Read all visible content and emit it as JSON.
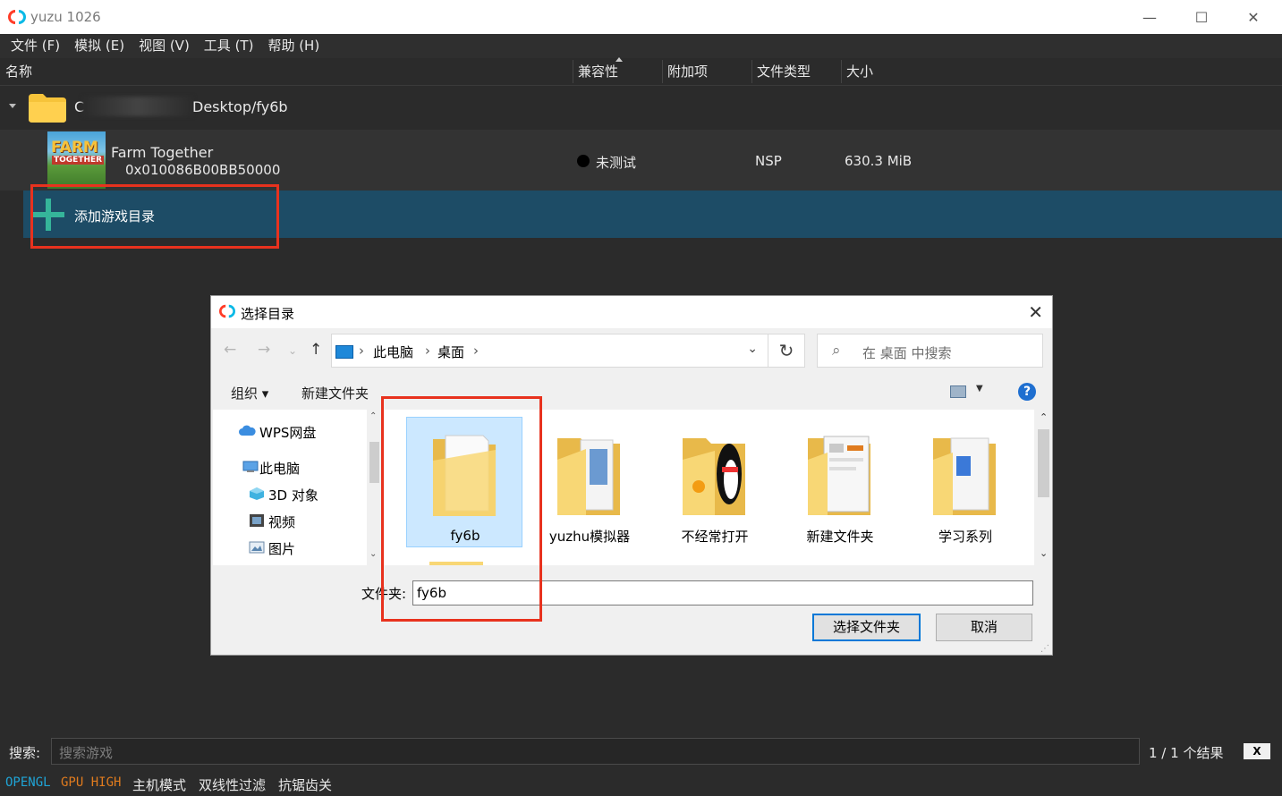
{
  "window": {
    "title": "yuzu 1026",
    "minimize": "—",
    "maximize": "☐",
    "close": "✕"
  },
  "menu": [
    "文件 (F)",
    "模拟 (E)",
    "视图 (V)",
    "工具 (T)",
    "帮助 (H)"
  ],
  "list": {
    "headers": {
      "name": "名称",
      "compat": "兼容性",
      "addons": "附加项",
      "filetype": "文件类型",
      "size": "大小"
    },
    "folder": {
      "path_start": "C",
      "path_end": "Desktop/fy6b"
    },
    "game": {
      "name": "Farm Together",
      "title_id": "0x010086B00BB50000",
      "compat": "未测试",
      "filetype": "NSP",
      "size": "630.3 MiB",
      "cover_line1": "FARM",
      "cover_line2": "TOGETHER"
    },
    "add_dir": "添加游戏目录"
  },
  "dialog": {
    "title": "选择目录",
    "close": "✕",
    "breadcrumb": [
      "此电脑",
      "桌面"
    ],
    "search_placeholder": "在 桌面 中搜索",
    "toolbar": {
      "organize": "组织 ▾",
      "new_folder": "新建文件夹",
      "help": "?"
    },
    "nav": [
      {
        "label": "WPS网盘",
        "icon": "cloud-icon"
      },
      {
        "label": "此电脑",
        "icon": "computer-icon"
      },
      {
        "label": "3D 对象",
        "icon": "cube-icon"
      },
      {
        "label": "视频",
        "icon": "video-icon"
      },
      {
        "label": "图片",
        "icon": "picture-icon"
      }
    ],
    "folders": [
      "fy6b",
      "yuzhu模拟器",
      "不经常打开",
      "新建文件夹",
      "学习系列"
    ],
    "selected_folder": "fy6b",
    "filename_label": "文件夹:",
    "filename_value": "fy6b",
    "select_button": "选择文件夹",
    "cancel_button": "取消"
  },
  "search": {
    "label": "搜索:",
    "placeholder": "搜索游戏",
    "count": "1 / 1 个结果",
    "clear": "X"
  },
  "status": {
    "api": "OPENGL",
    "gpu": "GPU HIGH",
    "mode": "主机模式",
    "filter": "双线性过滤",
    "aa": "抗锯齿关"
  },
  "colors": {
    "highlight_row": "#1d4c66",
    "plus": "#35b59a",
    "annotation": "#e8321e",
    "api_color": "#1fa4d6",
    "gpu_color": "#e07b1e"
  }
}
